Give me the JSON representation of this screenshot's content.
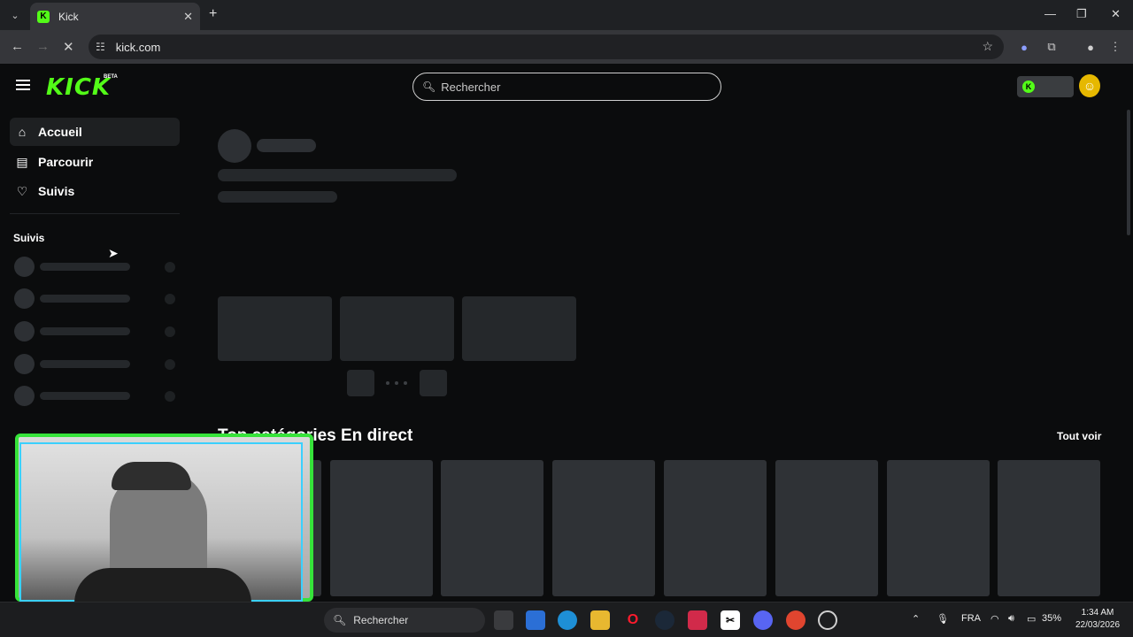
{
  "browser": {
    "tab_title": "Kick",
    "url": "kick.com",
    "new_tab": "+",
    "minimize": "—",
    "maximize": "❐",
    "close": "✕"
  },
  "header": {
    "logo": "KICK",
    "logo_badge": "BETA",
    "search_placeholder": "Rechercher"
  },
  "sidebar": {
    "items": [
      {
        "label": "Accueil",
        "icon": "home-icon"
      },
      {
        "label": "Parcourir",
        "icon": "browse-icon"
      },
      {
        "label": "Suivis",
        "icon": "heart-icon"
      }
    ],
    "section_title": "Suivis"
  },
  "main": {
    "categories_title": "Top catégories En direct",
    "see_all": "Tout voir"
  },
  "taskbar": {
    "search_label": "Rechercher",
    "language": "FRA",
    "battery": "35%",
    "time": "1:34 AM",
    "date": "22/03/2026"
  },
  "colors": {
    "brand": "#53fc18",
    "background": "#0b0c0d"
  }
}
